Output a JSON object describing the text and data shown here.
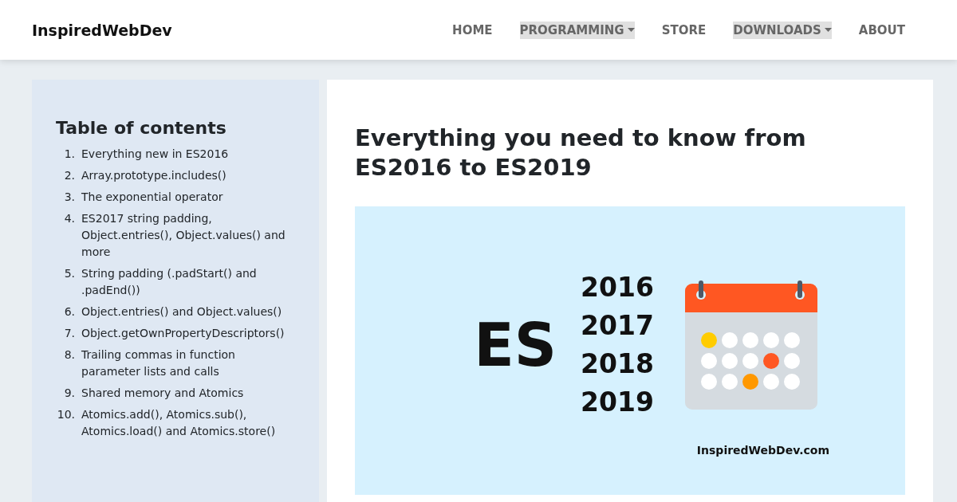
{
  "header": {
    "logo": "InspiredWebDev",
    "nav": [
      {
        "label": "HOME",
        "kind": "link"
      },
      {
        "label": "PROGRAMMING",
        "kind": "dropdown"
      },
      {
        "label": "STORE",
        "kind": "link"
      },
      {
        "label": "DOWNLOADS",
        "kind": "dropdown"
      },
      {
        "label": "ABOUT",
        "kind": "link"
      }
    ]
  },
  "sidebar": {
    "title": "Table of contents",
    "items": [
      {
        "number": "1.",
        "text": "Everything new in ES2016"
      },
      {
        "number": "2.",
        "text": "Array.prototype.includes()"
      },
      {
        "number": "3.",
        "text": "The exponential operator"
      },
      {
        "number": "4.",
        "text": "ES2017 string padding, Object.entries(), Object.values() and more"
      },
      {
        "number": "5.",
        "text": "String padding (.padStart() and .padEnd())"
      },
      {
        "number": "6.",
        "text": "Object.entries() and Object.values()"
      },
      {
        "number": "7.",
        "text": "Object.getOwnPropertyDescriptors()"
      },
      {
        "number": "8.",
        "text": "Trailing commas in function parameter lists and calls"
      },
      {
        "number": "9.",
        "text": "Shared memory and Atomics"
      },
      {
        "number": "10.",
        "text": "Atomics.add(), Atomics.sub(), Atomics.load() and Atomics.store()"
      }
    ]
  },
  "article": {
    "title": "Everything you need to know from ES2016 to ES2019",
    "banner": {
      "big_text": "ES",
      "years": [
        "2016",
        "2017",
        "2018",
        "2019"
      ],
      "site": "InspiredWebDev.com",
      "calendar_days": [
        {
          "color": "#ffcc00"
        },
        {
          "color": "#ffffff"
        },
        {
          "color": "#ffffff"
        },
        {
          "color": "#ffffff"
        },
        {
          "color": "#ffffff"
        },
        {
          "color": "#ffffff"
        },
        {
          "color": "#ffffff"
        },
        {
          "color": "#ffffff"
        },
        {
          "color": "#ff5722"
        },
        {
          "color": "#ffffff"
        },
        {
          "color": "#ffffff"
        },
        {
          "color": "#ffffff"
        },
        {
          "color": "#ff9800"
        },
        {
          "color": "#ffffff"
        },
        {
          "color": "#ffffff"
        }
      ]
    }
  }
}
